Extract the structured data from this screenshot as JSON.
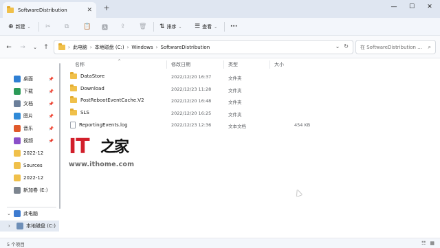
{
  "window": {
    "tab_title": "SoftwareDistribution",
    "tab_close": "✕",
    "new_tab": "+",
    "minimize": "—",
    "maximize": "☐",
    "close": "✕"
  },
  "toolbar": {
    "new_label": "新建",
    "new_icon": "⊕",
    "cut_icon": "✂",
    "copy_icon": "⧉",
    "paste_icon": "📋",
    "rename_icon": "🅰",
    "share_icon": "⇪",
    "delete_icon": "🗑",
    "sort_label": "排序",
    "sort_icon": "⇅",
    "view_label": "查看",
    "view_icon": "☰",
    "more_icon": "···"
  },
  "nav": {
    "back": "←",
    "forward": "→",
    "recent": "⌄",
    "up": "↑",
    "refresh": "↻",
    "expand": "⌄"
  },
  "address": {
    "crumbs": [
      "此电脑",
      "本地磁盘 (C:)",
      "Windows",
      "SoftwareDistribution"
    ],
    "separator": "›",
    "search_placeholder": "在 SoftwareDistribution ...",
    "search_icon": "⌕"
  },
  "sidebar": {
    "quick": [
      {
        "label": "桌面",
        "icon_color": "#2f7fd3"
      },
      {
        "label": "下载",
        "icon_color": "#2b9a57"
      },
      {
        "label": "文档",
        "icon_color": "#6b7f9a"
      },
      {
        "label": "图片",
        "icon_color": "#2f8ad8"
      },
      {
        "label": "音乐",
        "icon_color": "#e0592b"
      },
      {
        "label": "视频",
        "icon_color": "#8a4fc9"
      },
      {
        "label": "2022-12",
        "icon_color": "#f0c04a"
      },
      {
        "label": "Sources",
        "icon_color": "#f0c04a"
      },
      {
        "label": "2022-12",
        "icon_color": "#f0c04a"
      },
      {
        "label": "新加卷 (E:)",
        "icon_color": "#7d858f"
      }
    ],
    "pin": "📌",
    "this_pc": "此电脑",
    "local_disk": "本地磁盘 (C:)",
    "expand_open": "⌄",
    "expand_closed": "›"
  },
  "columns": {
    "name": "名称",
    "date": "修改日期",
    "type": "类型",
    "size": "大小",
    "sort_caret": "^"
  },
  "files": [
    {
      "name": "DataStore",
      "date": "2022/12/20 16:37",
      "type": "文件夹",
      "size": "",
      "is_folder": true
    },
    {
      "name": "Download",
      "date": "2022/12/23 11:28",
      "type": "文件夹",
      "size": "",
      "is_folder": true
    },
    {
      "name": "PostRebootEventCache.V2",
      "date": "2022/12/20 16:48",
      "type": "文件夹",
      "size": "",
      "is_folder": true
    },
    {
      "name": "SLS",
      "date": "2022/12/20 16:25",
      "type": "文件夹",
      "size": "",
      "is_folder": true
    },
    {
      "name": "ReportingEvents.log",
      "date": "2022/12/23 12:36",
      "type": "文本文档",
      "size": "454 KB",
      "is_folder": false
    }
  ],
  "watermark": {
    "brand": "IT",
    "brand_zh": "之家",
    "url": "www.ithome.com"
  },
  "status": {
    "count": "5 个项目",
    "details_icon": "☷",
    "tiles_icon": "▦"
  },
  "colors": {
    "accent": "#0067c0",
    "folder": "#f0c04a",
    "logo_red": "#d21f2b"
  }
}
